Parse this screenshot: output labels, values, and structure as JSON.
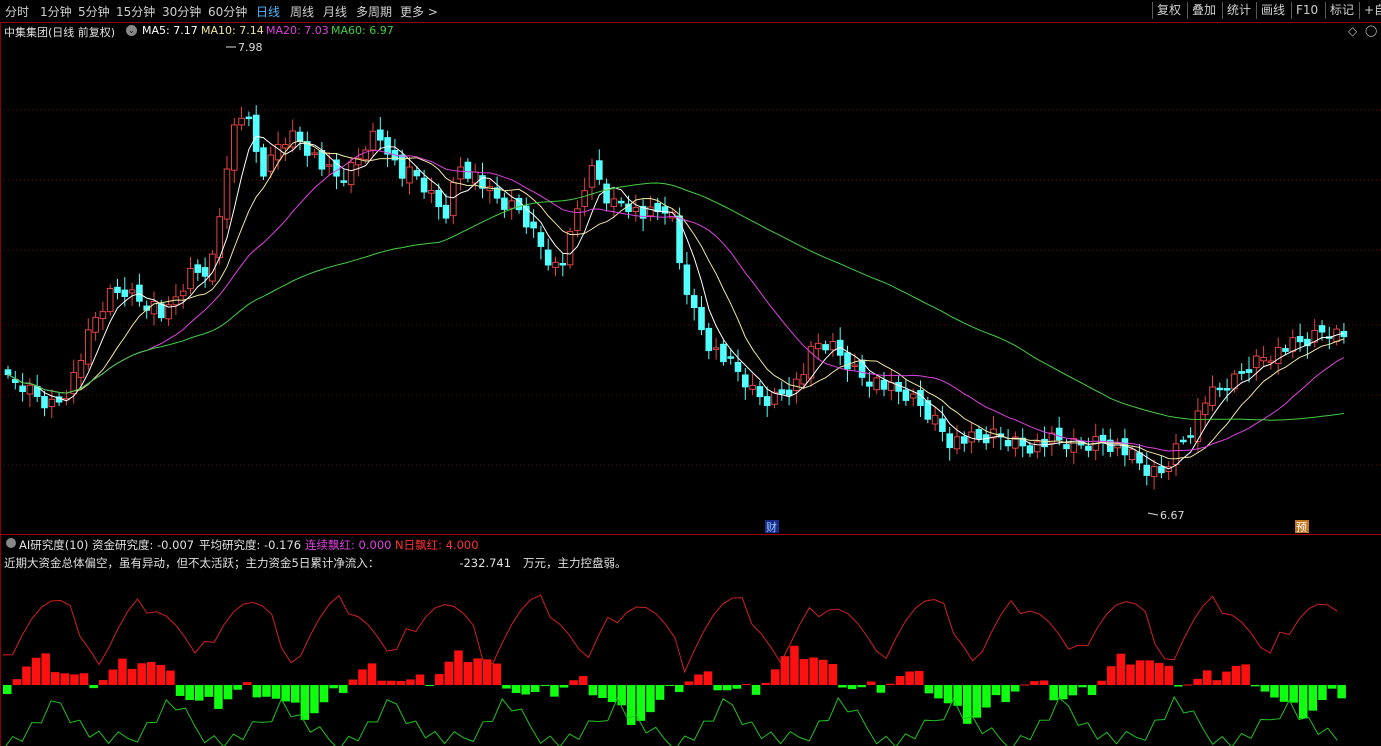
{
  "toolbar": {
    "periods": [
      "分时",
      "1分钟",
      "5分钟",
      "15分钟",
      "30分钟",
      "60分钟",
      "日线",
      "周线",
      "月线",
      "多周期",
      "更多 >"
    ],
    "active_period": "日线",
    "right_buttons": [
      "复权",
      "叠加",
      "统计",
      "画线",
      "F10",
      "标记",
      "+自"
    ]
  },
  "header": {
    "title": "中集集团(日线 前复权)",
    "ma5": "MA5: 7.17",
    "ma10": "MA10: 7.14",
    "ma20": "MA20: 7.03",
    "ma60": "MA60: 6.97",
    "diamond_icon": "diamond-icon"
  },
  "colors": {
    "up": "#e24242",
    "down": "#54ffff",
    "ma5": "#ffffff",
    "ma10": "#f0e6a0",
    "ma20": "#e040e0",
    "ma60": "#40d040",
    "grid": "#6a1010",
    "ind_pos": "#ff1010",
    "ind_neg": "#10ff10"
  },
  "markers": {
    "high_label": "7.98",
    "low_label": "6.67",
    "cai_badge": "财",
    "yu_badge": "预"
  },
  "indicator": {
    "name": "AI研究度(10)",
    "fund": "资金研究度: -0.007",
    "avg": "平均研究度: -0.176",
    "lianxu": "连续飘红: 0.000",
    "nri": "N日飘红: 4.000",
    "sentence_prefix": "近期大资金总体偏空，虽有异动，但不太活跃；主力资金5日累计净流入：",
    "sentence_value": "-232.741",
    "sentence_suffix": "万元，主力控盘弱。"
  },
  "chart_data": {
    "type": "candlestick",
    "symbol": "中集集团",
    "y_high": 7.98,
    "y_low": 6.67,
    "price_range": [
      6.6,
      8.2
    ]
  }
}
